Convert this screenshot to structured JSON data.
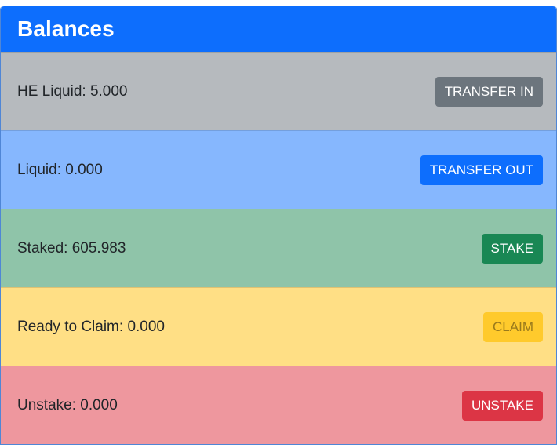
{
  "header": {
    "title": "Balances"
  },
  "rows": [
    {
      "label": "HE Liquid: 5.000",
      "button": "TRANSFER IN"
    },
    {
      "label": "Liquid: 0.000",
      "button": "TRANSFER OUT"
    },
    {
      "label": "Staked: 605.983",
      "button": "STAKE"
    },
    {
      "label": "Ready to Claim: 0.000",
      "button": "CLAIM"
    },
    {
      "label": "Unstake: 0.000",
      "button": "UNSTAKE"
    }
  ],
  "colors": {
    "header_bg": "#0d6efd",
    "secondary": "#6c757d",
    "primary": "#0d6efd",
    "success": "#198754",
    "warning": "#ffca2c",
    "danger": "#dc3545"
  }
}
